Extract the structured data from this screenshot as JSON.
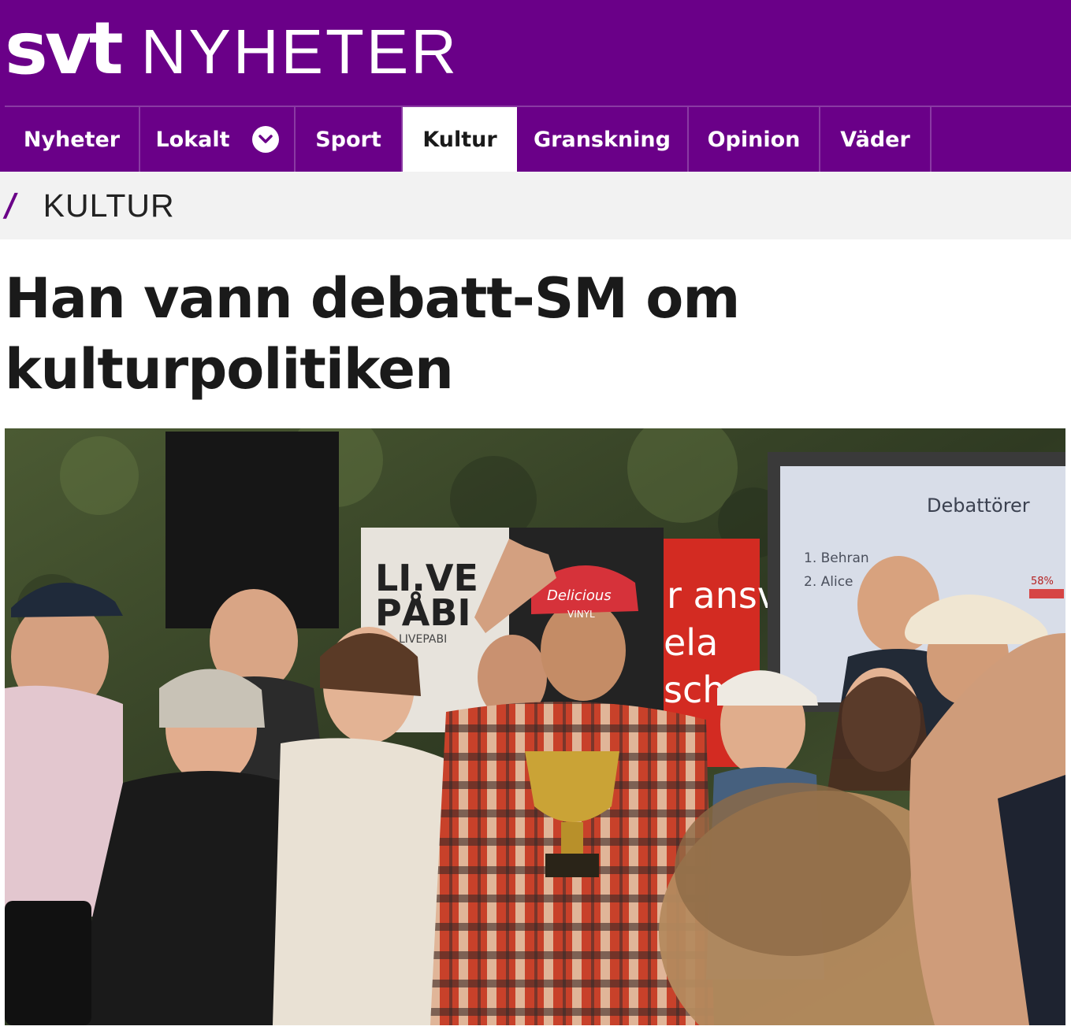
{
  "header": {
    "brand_svt": "svt",
    "brand_section": "NYHETER",
    "background_color": "#6a0088"
  },
  "nav": {
    "items": [
      {
        "label": "Nyheter",
        "active": false
      },
      {
        "label": "Lokalt",
        "active": false,
        "has_dropdown": true,
        "dropdown_icon": "chevron-down-icon"
      },
      {
        "label": "Sport",
        "active": false
      },
      {
        "label": "Kultur",
        "active": true
      },
      {
        "label": "Granskning",
        "active": false
      },
      {
        "label": "Opinion",
        "active": false
      },
      {
        "label": "Väder",
        "active": false
      }
    ]
  },
  "section": {
    "slash": "/",
    "title": "KULTUR",
    "accent_color": "#6a0088"
  },
  "article": {
    "headline_line1": "Han vann debatt-SM om",
    "headline_line2": "kulturpolitiken"
  },
  "photo": {
    "signs": {
      "banner_left_line1": "LI.VE",
      "banner_left_line2": "PÅBI",
      "banner_left_small": "LIVEPABI",
      "banner_red_line1": "r ansv",
      "banner_red_line2": "ela",
      "banner_red_line3": "sch",
      "screen_title": "Debattörer",
      "screen_item1": "1.  Behran",
      "screen_item2": "2.  Alice",
      "screen_percent": "58%",
      "cap_text_line1": "Delicious",
      "cap_text_line2": "VINYL"
    }
  }
}
